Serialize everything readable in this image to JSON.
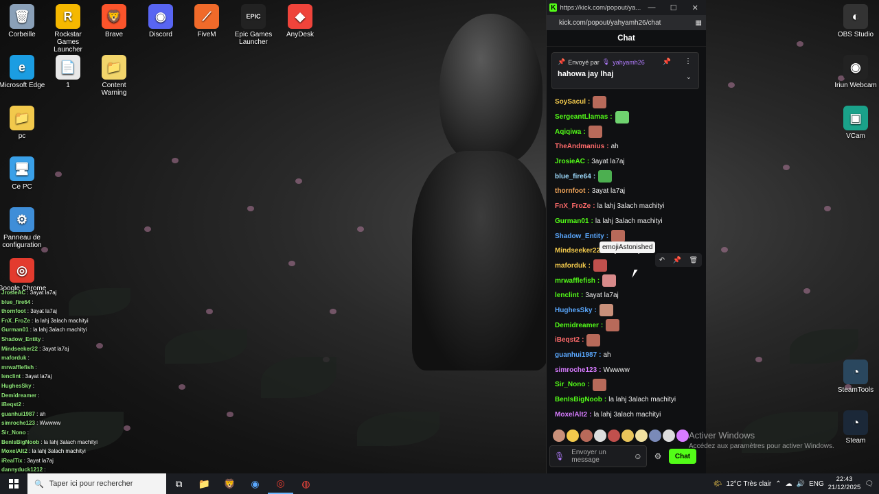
{
  "desktop_icons": [
    {
      "label": "Corbeille",
      "glyph": "🗑",
      "color": "#8aa0b8"
    },
    {
      "label": "Rockstar Games Launcher",
      "glyph": "R",
      "color": "#f5b800"
    },
    {
      "label": "Brave",
      "glyph": "🦁",
      "color": "#fb542b"
    },
    {
      "label": "Discord",
      "glyph": "◉",
      "color": "#5865f2"
    },
    {
      "label": "FiveM",
      "glyph": "⟋",
      "color": "#f06a2a"
    },
    {
      "label": "Epic Games Launcher",
      "glyph": "EPIC",
      "color": "#222222"
    },
    {
      "label": "AnyDesk",
      "glyph": "◆",
      "color": "#ef443b"
    },
    {
      "label": "Microsoft Edge",
      "glyph": "e",
      "color": "#1b9de2"
    },
    {
      "label": "1",
      "glyph": "📄",
      "color": "#e8e8e8"
    },
    {
      "label": "Content Warning",
      "glyph": "📁",
      "color": "#f2d56b"
    },
    {
      "label": "pc",
      "glyph": "📁",
      "color": "#f2c94c"
    },
    {
      "label": "Ce PC",
      "glyph": "🖥",
      "color": "#3aa0e8"
    },
    {
      "label": "Panneau de configuration",
      "glyph": "⚙",
      "color": "#3f8ed8"
    },
    {
      "label": "Google Chrome",
      "glyph": "◎",
      "color": "#e33b2e"
    },
    {
      "label": "OBS Studio",
      "glyph": "◐",
      "color": "#333333"
    },
    {
      "label": "Iriun Webcam",
      "glyph": "◉",
      "color": "#222222"
    },
    {
      "label": "VCam",
      "glyph": "▣",
      "color": "#1aa28a"
    },
    {
      "label": "SteamTools",
      "glyph": "◔",
      "color": "#2a475e"
    },
    {
      "label": "Steam",
      "glyph": "◔",
      "color": "#1b2838"
    }
  ],
  "overlay_chat": [
    {
      "user": "JrosieAC",
      "text": ": 3ayat la7aj"
    },
    {
      "user": "blue_fire64",
      "text": ":"
    },
    {
      "user": "thornfoot",
      "text": ": 3ayat la7aj"
    },
    {
      "user": "FnX_FroZe",
      "text": ": la lahj 3alach machityi"
    },
    {
      "user": "Gurman01",
      "text": ": la lahj 3alach machityi"
    },
    {
      "user": "Shadow_Entity",
      "text": ":"
    },
    {
      "user": "Mindseeker22",
      "text": ": 3ayat la7aj"
    },
    {
      "user": "maforduk",
      "text": ":"
    },
    {
      "user": "mrwafflefish",
      "text": ":"
    },
    {
      "user": "lenclint",
      "text": ": 3ayat la7aj"
    },
    {
      "user": "HughesSky",
      "text": ":"
    },
    {
      "user": "Demidreamer",
      "text": ":"
    },
    {
      "user": "iBeqst2",
      "text": ":"
    },
    {
      "user": "guanhui1987",
      "text": ": ah"
    },
    {
      "user": "simroche123",
      "text": ": Wwwww"
    },
    {
      "user": "Sir_Nono",
      "text": ":"
    },
    {
      "user": "BenIsBigNoob",
      "text": ": la lahj 3alach machityi"
    },
    {
      "user": "MoxelAlt2",
      "text": ": la lahj 3alach machityi"
    },
    {
      "user": "iRealTix",
      "text": ": 3ayat la7aj"
    },
    {
      "user": "dannyduck1212",
      "text": ":"
    }
  ],
  "popout": {
    "title_url": "https://kick.com/popout/ya...",
    "address": "kick.com/popout/yahyamh26/chat",
    "chat_title": "Chat",
    "pinned": {
      "sent_by": "Envoyé par",
      "user": "yahyamh26",
      "message": "hahowa jay lhaj"
    },
    "messages": [
      {
        "user": "SoySacul",
        "color": "#f2c94c",
        "text": "",
        "emote": "#b86a5a"
      },
      {
        "user": "SergeantLlamas",
        "color": "#53fc18",
        "text": "",
        "emote": "#6fd36f"
      },
      {
        "user": "Aqiqiwa",
        "color": "#53fc18",
        "text": "",
        "emote": "#b86a5a"
      },
      {
        "user": "TheAndmanius",
        "color": "#ff6b6b",
        "text": "ah",
        "emote": ""
      },
      {
        "user": "JrosieAC",
        "color": "#53fc18",
        "text": "3ayat la7aj",
        "emote": ""
      },
      {
        "user": "blue_fire64",
        "color": "#9fdcff",
        "text": "",
        "emote": "#4caf50"
      },
      {
        "user": "thornfoot",
        "color": "#f2a65a",
        "text": "3ayat la7aj",
        "emote": ""
      },
      {
        "user": "FnX_FroZe",
        "color": "#ff6b6b",
        "text": "la lahj 3alach machityi",
        "emote": ""
      },
      {
        "user": "Gurman01",
        "color": "#53fc18",
        "text": "la lahj 3alach machityi",
        "emote": ""
      },
      {
        "user": "Shadow_Entity",
        "color": "#5aa8ff",
        "text": "",
        "emote": "#b86a5a"
      },
      {
        "user": "Mindseeker22",
        "color": "#f2c94c",
        "text": "3ayat la7aj",
        "emote": ""
      },
      {
        "user": "maforduk",
        "color": "#f2c94c",
        "text": "",
        "emote": "#c0504d"
      },
      {
        "user": "mrwafflefish",
        "color": "#53fc18",
        "text": "",
        "emote": "#d88a8a"
      },
      {
        "user": "lenclint",
        "color": "#53fc18",
        "text": "3ayat la7aj",
        "emote": ""
      },
      {
        "user": "HughesSky",
        "color": "#5aa8ff",
        "text": "",
        "emote": "#c9907a"
      },
      {
        "user": "Demidreamer",
        "color": "#53fc18",
        "text": "",
        "emote": "#b86a5a"
      },
      {
        "user": "iBeqst2",
        "color": "#ff6b6b",
        "text": "",
        "emote": "#b86a5a"
      },
      {
        "user": "guanhui1987",
        "color": "#5aa8ff",
        "text": "ah",
        "emote": ""
      },
      {
        "user": "simroche123",
        "color": "#d77cff",
        "text": "Wwwww",
        "emote": ""
      },
      {
        "user": "Sir_Nono",
        "color": "#53fc18",
        "text": "",
        "emote": "#b86a5a"
      },
      {
        "user": "BenIsBigNoob",
        "color": "#53fc18",
        "text": "la lahj 3alach machityi",
        "emote": ""
      },
      {
        "user": "MoxelAlt2",
        "color": "#d77cff",
        "text": "la lahj 3alach machityi",
        "emote": ""
      }
    ],
    "tooltip": "emojiAstonished",
    "input_placeholder": "Envoyer un message",
    "send_label": "Chat"
  },
  "activate_windows": {
    "title": "Activer Windows",
    "subtitle": "Accédez aux paramètres pour activer Windows."
  },
  "taskbar": {
    "search_placeholder": "Taper ici pour rechercher",
    "weather": "12°C  Très clair",
    "language": "ENG",
    "time": "22:43",
    "date": "21/12/2025"
  },
  "colors": {
    "kick_green": "#53fc18",
    "popout_bg": "#0f1012",
    "taskbar_bg": "#1b1d22"
  }
}
